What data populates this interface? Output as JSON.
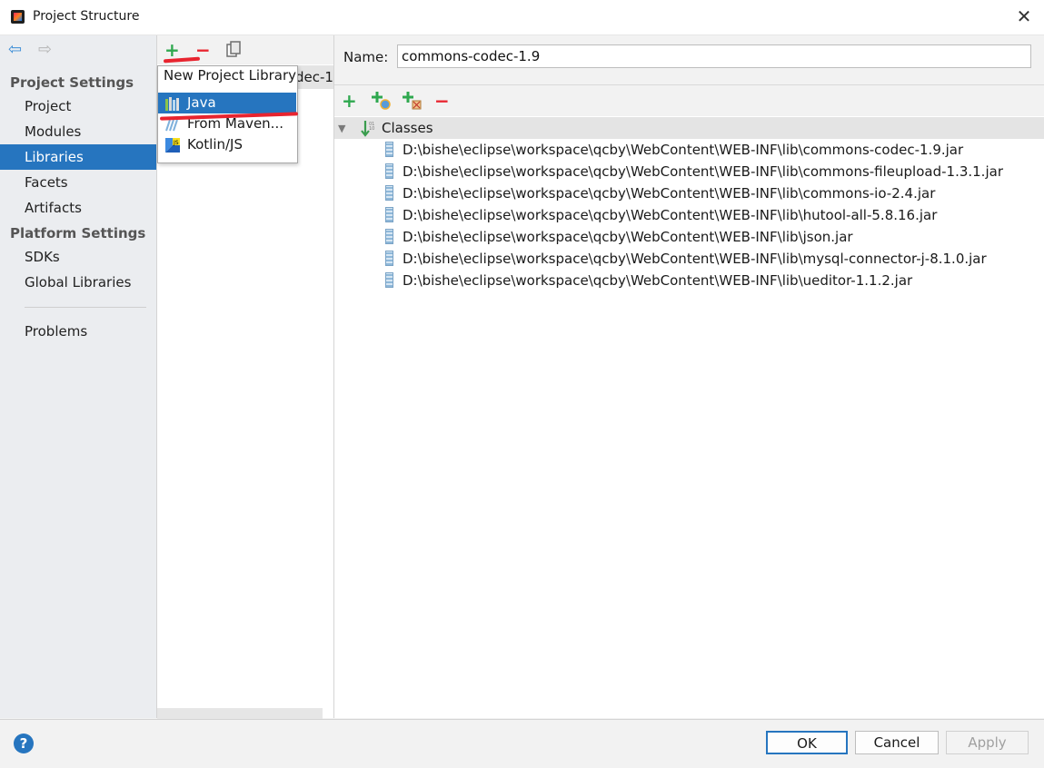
{
  "window": {
    "title": "Project Structure",
    "close_symbol": "✕"
  },
  "sidebar": {
    "project_settings_heading": "Project Settings",
    "platform_settings_heading": "Platform Settings",
    "items": [
      {
        "label": "Project"
      },
      {
        "label": "Modules"
      },
      {
        "label": "Libraries"
      },
      {
        "label": "Facets"
      },
      {
        "label": "Artifacts"
      },
      {
        "label": "SDKs"
      },
      {
        "label": "Global Libraries"
      },
      {
        "label": "Problems"
      }
    ],
    "selected": "Libraries"
  },
  "middle": {
    "list_item_partial": "dec-1."
  },
  "popup": {
    "title": "New Project Library",
    "items": [
      {
        "label": "Java",
        "icon": "java-library-icon"
      },
      {
        "label": "From Maven...",
        "icon": "maven-icon"
      },
      {
        "label": "Kotlin/JS",
        "icon": "kotlin-js-icon"
      }
    ],
    "selected": "Java"
  },
  "detail": {
    "name_label": "Name:",
    "name_value": "commons-codec-1.9",
    "classes_label": "Classes",
    "jars": [
      "D:\\bishe\\eclipse\\workspace\\qcby\\WebContent\\WEB-INF\\lib\\commons-codec-1.9.jar",
      "D:\\bishe\\eclipse\\workspace\\qcby\\WebContent\\WEB-INF\\lib\\commons-fileupload-1.3.1.jar",
      "D:\\bishe\\eclipse\\workspace\\qcby\\WebContent\\WEB-INF\\lib\\commons-io-2.4.jar",
      "D:\\bishe\\eclipse\\workspace\\qcby\\WebContent\\WEB-INF\\lib\\hutool-all-5.8.16.jar",
      "D:\\bishe\\eclipse\\workspace\\qcby\\WebContent\\WEB-INF\\lib\\json.jar",
      "D:\\bishe\\eclipse\\workspace\\qcby\\WebContent\\WEB-INF\\lib\\mysql-connector-j-8.1.0.jar",
      "D:\\bishe\\eclipse\\workspace\\qcby\\WebContent\\WEB-INF\\lib\\ueditor-1.1.2.jar"
    ]
  },
  "buttons": {
    "ok": "OK",
    "cancel": "Cancel",
    "apply": "Apply",
    "help": "?"
  },
  "colors": {
    "accent": "#2675bf",
    "add_green": "#2fa84f",
    "remove_red": "#e8242f",
    "annotation_red": "#e8242f"
  }
}
